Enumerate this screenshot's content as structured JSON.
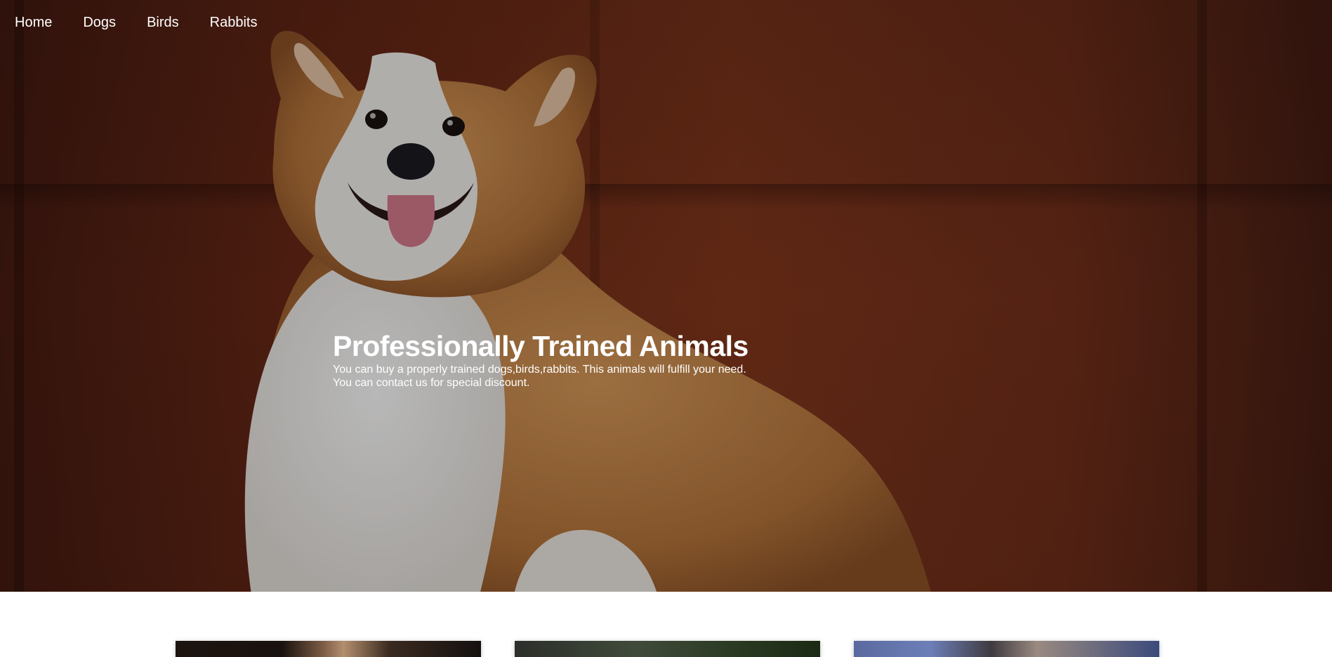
{
  "nav": {
    "items": [
      {
        "label": "Home"
      },
      {
        "label": "Dogs"
      },
      {
        "label": "Birds"
      },
      {
        "label": "Rabbits"
      }
    ]
  },
  "hero": {
    "title": "Professionally Trained Animals",
    "description_line1": "You can buy a properly trained dogs,birds,rabbits. This animals will fulfill your need.",
    "description_line2": "You can contact us for special discount.",
    "colors": {
      "text": "#ffffff",
      "background": "#7a321c"
    }
  },
  "cards": {
    "count_visible": 3,
    "colors": {
      "page_background": "#ffffff"
    }
  }
}
